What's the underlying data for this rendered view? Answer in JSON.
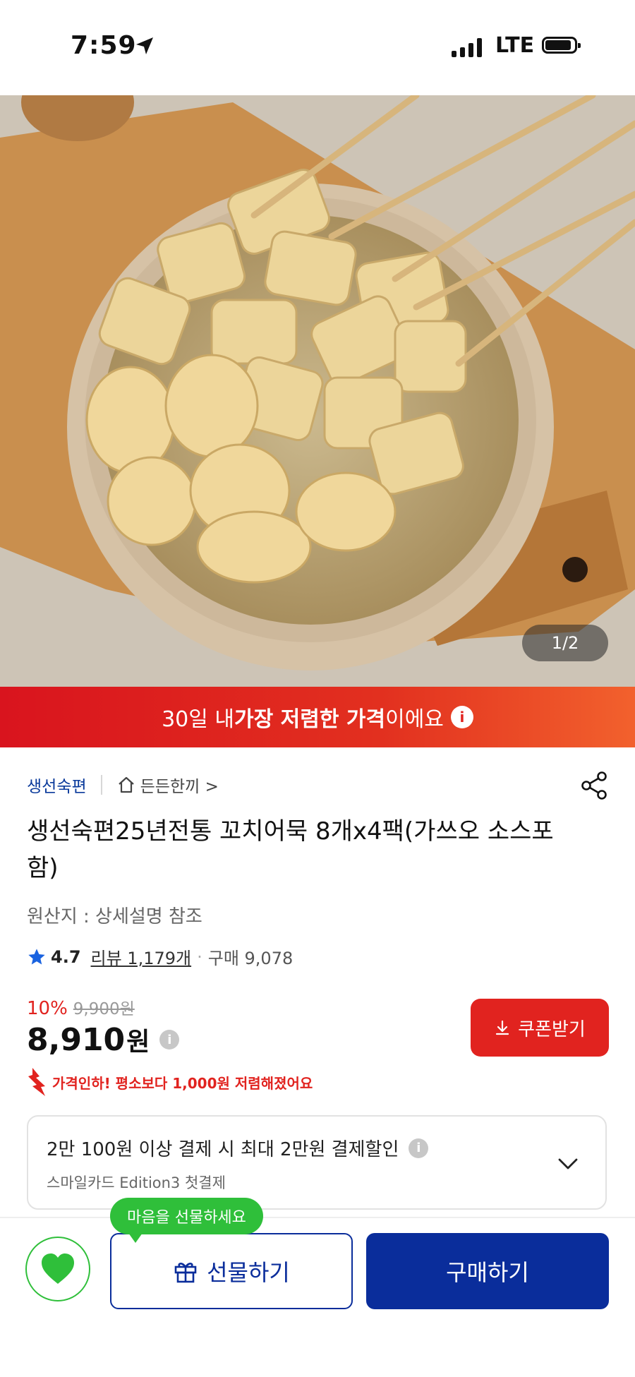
{
  "status_bar": {
    "time": "7:59",
    "network": "LTE"
  },
  "gallery": {
    "counter": "1/2",
    "image_description_icon": "product-photo"
  },
  "price_banner": {
    "pre": "30일 내 ",
    "bold": "가장 저렴한 가격",
    "post": "이에요"
  },
  "brand": {
    "name": "생선숙편",
    "category": "든든한끼 >"
  },
  "product": {
    "title": "생선숙편25년전통 꼬치어묵 8개x4팩(가쓰오 소스포함)",
    "origin": "원산지 : 상세설명 참조"
  },
  "rating": {
    "value": "4.7",
    "reviews": "리뷰 1,179개",
    "separator": "·",
    "purchases": "구매 9,078"
  },
  "price": {
    "discount": "10%",
    "original": "9,900원",
    "final_number": "8,910",
    "final_unit": "원",
    "coupon_label": "쿠폰받기",
    "drop_notice": "가격인하! 평소보다 1,000원 저렴해졌어요"
  },
  "card_promo": {
    "title": "2만 100원 이상 결제 시 최대 2만원 결제할인",
    "subtitle": "스마일카드 Edition3 첫결제"
  },
  "bottom_bar": {
    "gift_bubble": "마음을 선물하세요",
    "gift_label": "선물하기",
    "buy_label": "구매하기"
  },
  "colors": {
    "accent_red": "#e1231f",
    "brand_blue": "#0a2d9b",
    "green": "#2fbf3a"
  }
}
